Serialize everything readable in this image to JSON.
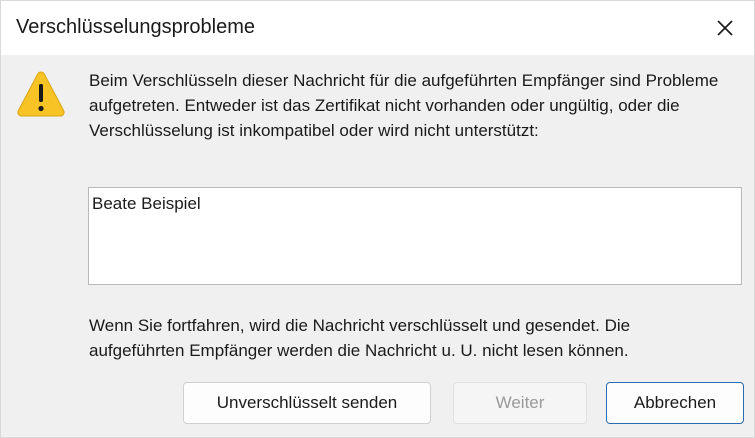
{
  "dialog": {
    "title": "Verschlüsselungsprobleme",
    "icon": "warning-icon",
    "message": "Beim Verschlüsseln dieser Nachricht für die aufgeführten Empfänger sind Probleme aufgetreten. Entweder ist das Zertifikat nicht vorhanden oder ungültig, oder die Verschlüsselung ist inkompatibel oder wird nicht unterstützt:",
    "recipients": [
      "Beate Beispiel"
    ],
    "note": "Wenn Sie fortfahren, wird die Nachricht verschlüsselt und gesendet. Die aufgeführten Empfänger werden die Nachricht u. U. nicht lesen können."
  },
  "buttons": {
    "send_unencrypted": "Unverschlüsselt senden",
    "continue": "Weiter",
    "cancel": "Abbrechen"
  },
  "colors": {
    "warning_yellow": "#f7c325",
    "primary_border": "#2b6cb0"
  }
}
